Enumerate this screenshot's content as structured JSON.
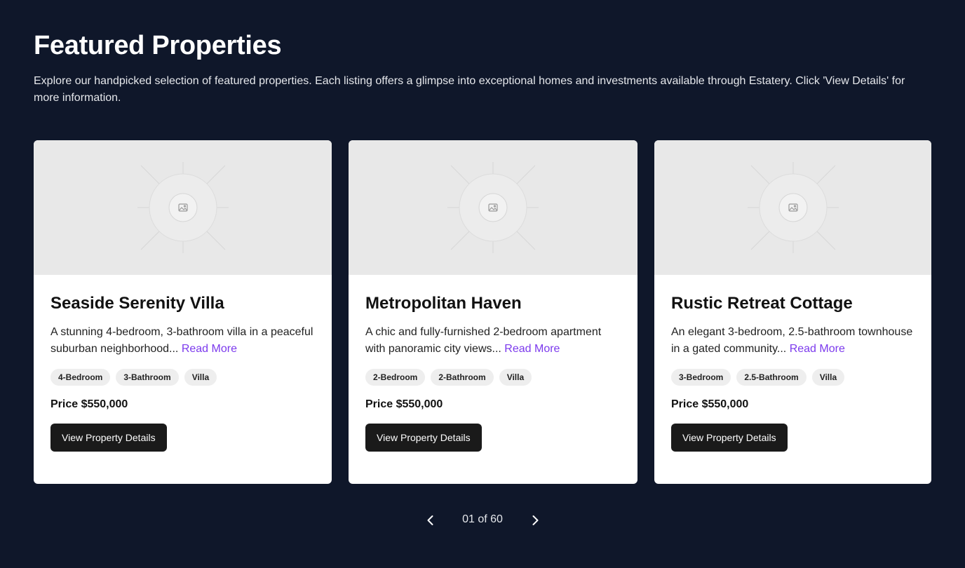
{
  "header": {
    "title": "Featured Properties",
    "subtitle": "Explore our handpicked selection of featured properties. Each listing offers a glimpse into exceptional homes and investments available through Estatery. Click 'View Details' for more information."
  },
  "cards": [
    {
      "title": "Seaside Serenity Villa",
      "description": "A stunning 4-bedroom, 3-bathroom villa in a peaceful suburban neighborhood...",
      "read_more": "Read More",
      "tags": [
        "4-Bedroom",
        "3-Bathroom",
        "Villa"
      ],
      "price": "Price $550,000",
      "button": "View Property Details"
    },
    {
      "title": "Metropolitan Haven",
      "description": "A chic and fully-furnished 2-bedroom apartment with panoramic city views...",
      "read_more": "Read More",
      "tags": [
        "2-Bedroom",
        "2-Bathroom",
        "Villa"
      ],
      "price": "Price $550,000",
      "button": "View Property Details"
    },
    {
      "title": "Rustic Retreat Cottage",
      "description": "An elegant 3-bedroom, 2.5-bathroom townhouse in a gated community...",
      "read_more": "Read More",
      "tags": [
        "3-Bedroom",
        "2.5-Bathroom",
        "Villa"
      ],
      "price": "Price $550,000",
      "button": "View Property Details"
    }
  ],
  "pagination": {
    "text": "01 of 60",
    "prev_icon": "chevron-left-icon",
    "next_icon": "chevron-right-icon"
  },
  "colors": {
    "background": "#0f172a",
    "accent": "#7c3aed",
    "button": "#1a1a1a"
  }
}
